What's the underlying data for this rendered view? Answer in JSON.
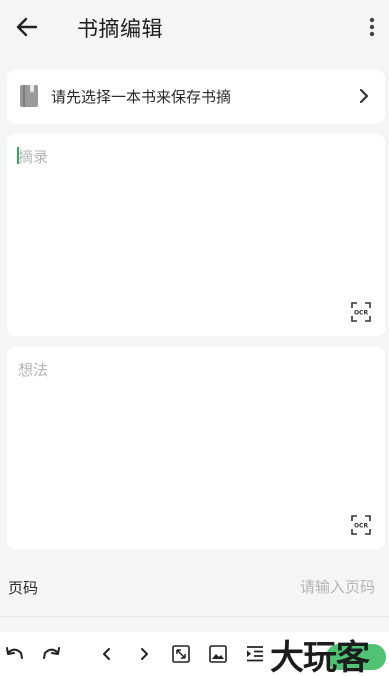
{
  "header": {
    "title": "书摘编辑"
  },
  "book_selector": {
    "label": "请先选择一本书来保存书摘"
  },
  "excerpt": {
    "placeholder": "摘录"
  },
  "thought": {
    "placeholder": "想法"
  },
  "page": {
    "label": "页码",
    "placeholder": "请输入页码"
  },
  "toolbar": {
    "icons": [
      "undo-icon",
      "redo-icon",
      "chevron-left-icon",
      "chevron-right-icon",
      "expand-icon",
      "image-icon",
      "indent-icon"
    ]
  },
  "watermark": {
    "text": "大玩客"
  },
  "colors": {
    "cursor": "#3aa35a",
    "watermark_accent": "#3dbb65",
    "background": "#f4f5f7"
  }
}
